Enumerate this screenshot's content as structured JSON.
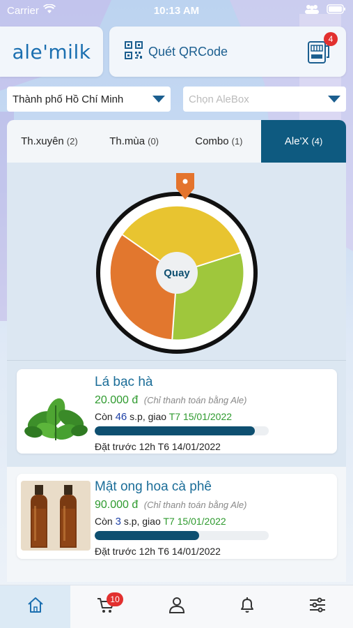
{
  "status_bar": {
    "carrier": "Carrier",
    "time": "10:13 AM"
  },
  "header": {
    "logo": "ale'milk",
    "qr_label": "Quét QRCode",
    "machine_badge": "4"
  },
  "filters": {
    "city": "Thành phố Hồ Chí Minh",
    "box_placeholder": "Chọn AleBox"
  },
  "tabs": [
    {
      "label": "Th.xuyên",
      "count": "(2)"
    },
    {
      "label": "Th.mùa",
      "count": "(0)"
    },
    {
      "label": "Combo",
      "count": "(1)"
    },
    {
      "label": "Ale'X",
      "count": "(4)"
    }
  ],
  "wheel": {
    "center_label": "Quay",
    "colors": [
      "#e8c430",
      "#9fc73c",
      "#e2772e"
    ]
  },
  "products": [
    {
      "name": "Lá bạc hà",
      "price": "20.000 đ",
      "price_note": "(Chỉ thanh toán bằng Ale)",
      "stock_prefix": "Còn",
      "stock_count": "46",
      "stock_suffix": "s.p, giao",
      "delivery": "T7 15/01/2022",
      "progress": 0.92,
      "order_deadline": "Đặt trước 12h T6 14/01/2022"
    },
    {
      "name": "Mật ong hoa cà phê",
      "price": "90.000 đ",
      "price_note": "(Chỉ thanh toán bằng Ale)",
      "stock_prefix": "Còn",
      "stock_count": "3",
      "stock_suffix": "s.p, giao",
      "delivery": "T7 15/01/2022",
      "progress": 0.6,
      "order_deadline": "Đặt trước 12h T6 14/01/2022"
    }
  ],
  "bottom_nav": {
    "cart_badge": "10"
  }
}
